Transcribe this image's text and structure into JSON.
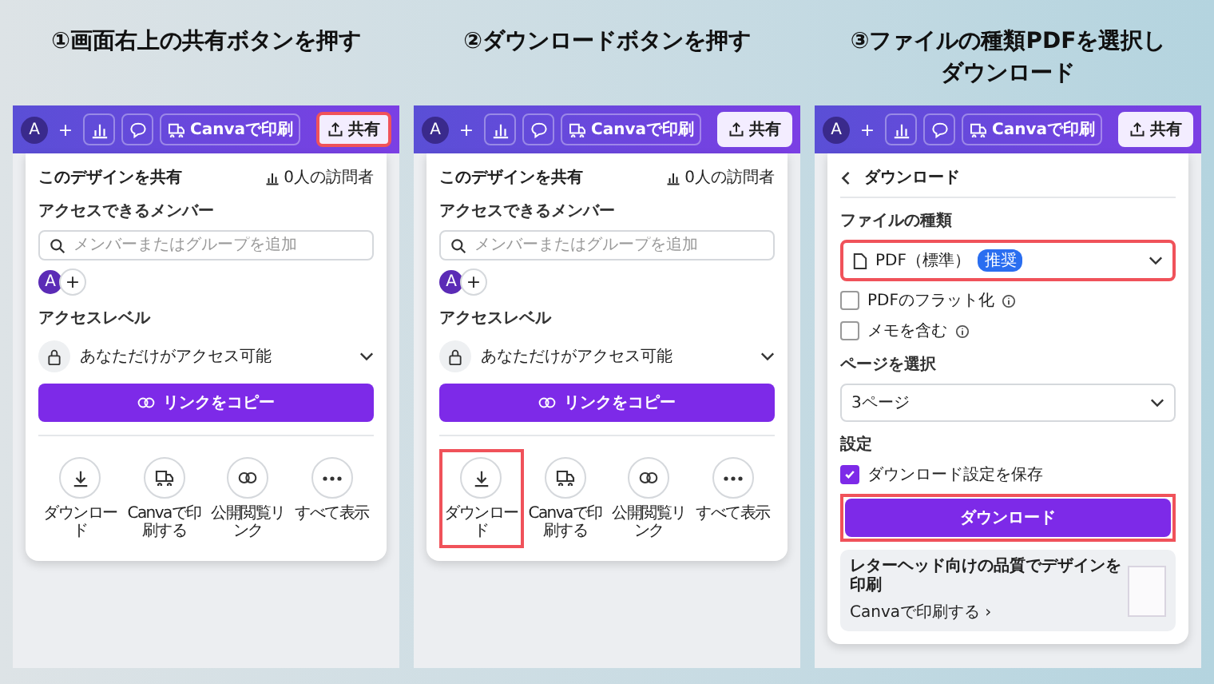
{
  "steps": [
    {
      "title_lines": [
        "①画面右上の共有ボタンを押す"
      ],
      "toolbar": {
        "avatar": "A",
        "plus": "+",
        "print": "Canvaで印刷",
        "share": {
          "label": "共有",
          "highlighted": true
        }
      },
      "panel": {
        "kind": "share",
        "title": "このデザインを共有",
        "visitors": "0人の訪問者",
        "members_label": "アクセスできるメンバー",
        "search_placeholder": "メンバーまたはグループを追加",
        "member_avatar": "A",
        "member_add": "+",
        "access_label": "アクセスレベル",
        "access_value": "あなただけがアクセス可能",
        "copy_button": "リンクをコピー",
        "actions": [
          {
            "kind": "download",
            "label": "ダウンロード",
            "highlighted": false
          },
          {
            "kind": "print",
            "label": "Canvaで印刷する",
            "highlighted": false
          },
          {
            "kind": "link",
            "label": "公開閲覧リンク",
            "highlighted": false
          },
          {
            "kind": "more",
            "label": "すべて表示",
            "highlighted": false
          }
        ]
      }
    },
    {
      "title_lines": [
        "②ダウンロードボタンを押す"
      ],
      "toolbar": {
        "avatar": "A",
        "plus": "+",
        "print": "Canvaで印刷",
        "share": {
          "label": "共有",
          "highlighted": false
        }
      },
      "panel": {
        "kind": "share",
        "title": "このデザインを共有",
        "visitors": "0人の訪問者",
        "members_label": "アクセスできるメンバー",
        "search_placeholder": "メンバーまたはグループを追加",
        "member_avatar": "A",
        "member_add": "+",
        "access_label": "アクセスレベル",
        "access_value": "あなただけがアクセス可能",
        "copy_button": "リンクをコピー",
        "actions": [
          {
            "kind": "download",
            "label": "ダウンロード",
            "highlighted": true
          },
          {
            "kind": "print",
            "label": "Canvaで印刷する",
            "highlighted": false
          },
          {
            "kind": "link",
            "label": "公開閲覧リンク",
            "highlighted": false
          },
          {
            "kind": "more",
            "label": "すべて表示",
            "highlighted": false
          }
        ]
      }
    },
    {
      "title_lines": [
        "③ファイルの種類PDFを選択し",
        "ダウンロード"
      ],
      "toolbar": {
        "avatar": "A",
        "plus": "+",
        "print": "Canvaで印刷",
        "share": {
          "label": "共有",
          "highlighted": false
        }
      },
      "panel": {
        "kind": "download",
        "title": "ダウンロード",
        "file_type_label": "ファイルの種類",
        "file_type": {
          "value": "PDF（標準）",
          "badge": "推奨",
          "highlighted": true
        },
        "options": [
          {
            "label": "PDFのフラット化",
            "checked": false
          },
          {
            "label": "メモを含む",
            "checked": false
          }
        ],
        "pages_label": "ページを選択",
        "pages_value": "3ページ",
        "settings_label": "設定",
        "save_setting": {
          "label": "ダウンロード設定を保存",
          "checked": true
        },
        "download_button": {
          "label": "ダウンロード",
          "highlighted": true
        },
        "promo": {
          "title": "レターヘッド向けの品質でデザインを印刷",
          "link": "Canvaで印刷する ›"
        }
      }
    }
  ]
}
